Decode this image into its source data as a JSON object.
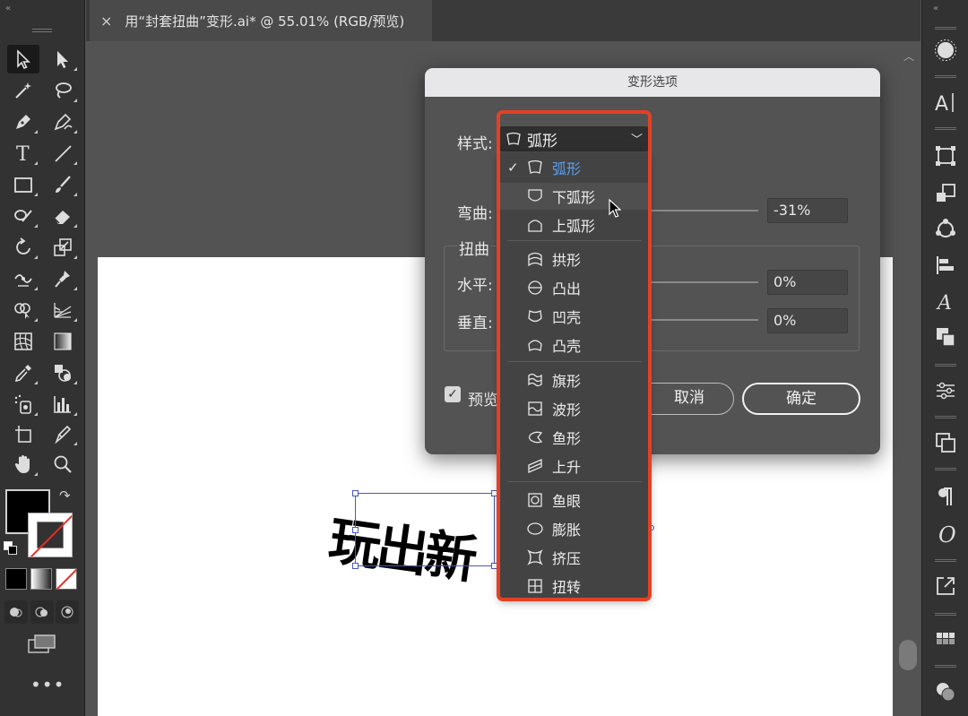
{
  "document": {
    "tab_title": "用“封套扭曲”变形.ai* @ 55.01% (RGB/预览)",
    "close_glyph": "×"
  },
  "toolbar": {
    "collapse_glyph": "«",
    "tools": [
      "selection-tool",
      "direct-selection-tool",
      "magic-wand-tool",
      "lasso-tool",
      "pen-tool",
      "curvature-tool",
      "type-tool",
      "line-tool",
      "rectangle-tool",
      "paintbrush-tool",
      "shaper-tool",
      "eraser-tool",
      "rotate-tool",
      "scale-tool",
      "width-tool",
      "puppet-warp-tool",
      "shape-builder-tool",
      "perspective-grid-tool",
      "mesh-tool",
      "gradient-tool",
      "eyedropper-tool",
      "blend-tool",
      "symbol-sprayer-tool",
      "column-graph-tool",
      "artboard-tool",
      "slice-tool",
      "hand-tool",
      "zoom-tool"
    ],
    "more_glyph": "•••",
    "fill_color": "#000000",
    "stroke_color": "none"
  },
  "right_panel": {
    "collapse_glyph": "«",
    "icons": [
      "appearance-icon",
      "character-icon",
      "transform-icon",
      "layers-icon",
      "artboards-icon",
      "align-icon",
      "glyphs-icon",
      "pathfinder-icon",
      "properties-icon",
      "libraries-icon",
      "paragraph-icon",
      "opentype-icon",
      "export-icon",
      "swatches-icon",
      "color-guide-icon"
    ]
  },
  "artwork": {
    "text": "玩出新"
  },
  "dialog": {
    "title": "变形选项",
    "style_label": "样式:",
    "style_value": "弧形",
    "bend_label": "弯曲:",
    "bend_value": "-31%",
    "distort_label": "扭曲",
    "horizontal_label": "水平:",
    "horizontal_value": "0%",
    "vertical_label": "垂直:",
    "vertical_value": "0%",
    "preview_label": "预览",
    "preview_checked": true,
    "cancel_label": "取消",
    "ok_label": "确定"
  },
  "style_menu": {
    "items": [
      {
        "label": "弧形",
        "icon": "arc-icon",
        "selected": true,
        "check": "✓"
      },
      {
        "label": "下弧形",
        "icon": "arc-lower-icon"
      },
      {
        "label": "上弧形",
        "icon": "arc-upper-icon"
      },
      {
        "label": "拱形",
        "icon": "arch-icon"
      },
      {
        "label": "凸出",
        "icon": "bulge-icon"
      },
      {
        "label": "凹壳",
        "icon": "shell-lower-icon"
      },
      {
        "label": "凸壳",
        "icon": "shell-upper-icon"
      },
      {
        "label": "旗形",
        "icon": "flag-icon"
      },
      {
        "label": "波形",
        "icon": "wave-icon"
      },
      {
        "label": "鱼形",
        "icon": "fish-icon"
      },
      {
        "label": "上升",
        "icon": "rise-icon"
      },
      {
        "label": "鱼眼",
        "icon": "fisheye-icon"
      },
      {
        "label": "膨胀",
        "icon": "inflate-icon"
      },
      {
        "label": "挤压",
        "icon": "squeeze-icon"
      },
      {
        "label": "扭转",
        "icon": "twist-icon"
      }
    ],
    "hovered": "下弧形"
  },
  "colors": {
    "highlight_border": "#e34125",
    "selected_item_text": "#5aa0f0",
    "selection_bbox": "#4a5ab8"
  }
}
